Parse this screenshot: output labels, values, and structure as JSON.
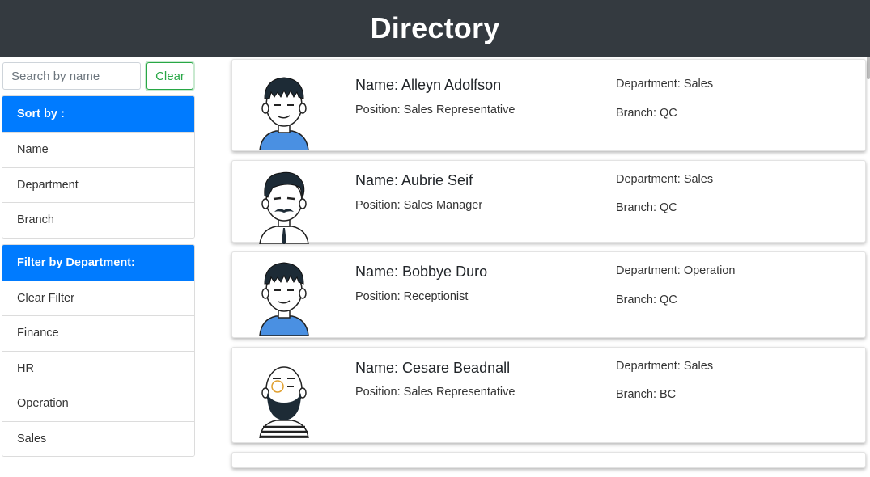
{
  "header": {
    "title": "Directory"
  },
  "search": {
    "placeholder": "Search by name",
    "clear_label": "Clear"
  },
  "sort": {
    "title": "Sort by :",
    "items": [
      "Name",
      "Department",
      "Branch"
    ]
  },
  "filter": {
    "title": "Filter by Department:",
    "items": [
      "Clear Filter",
      "Finance",
      "HR",
      "Operation",
      "Sales"
    ]
  },
  "employees": [
    {
      "name": "Name: Alleyn Adolfson",
      "position": "Position: Sales Representative",
      "department": "Department: Sales",
      "branch": "Branch: QC",
      "avatar": "avatar-bangs-icon"
    },
    {
      "name": "Name: Aubrie Seif",
      "position": "Position: Sales Manager",
      "department": "Department: Sales",
      "branch": "Branch: QC",
      "avatar": "avatar-mustache-icon"
    },
    {
      "name": "Name: Bobbye Duro",
      "position": "Position: Receptionist",
      "department": "Department: Operation",
      "branch": "Branch: QC",
      "avatar": "avatar-bangs-icon"
    },
    {
      "name": "Name: Cesare Beadnall",
      "position": "Position: Sales Representative",
      "department": "Department: Sales",
      "branch": "Branch: BC",
      "avatar": "avatar-bearded-icon"
    }
  ],
  "colors": {
    "header_bg": "#343a40",
    "primary": "#007bff",
    "success": "#28a745"
  }
}
